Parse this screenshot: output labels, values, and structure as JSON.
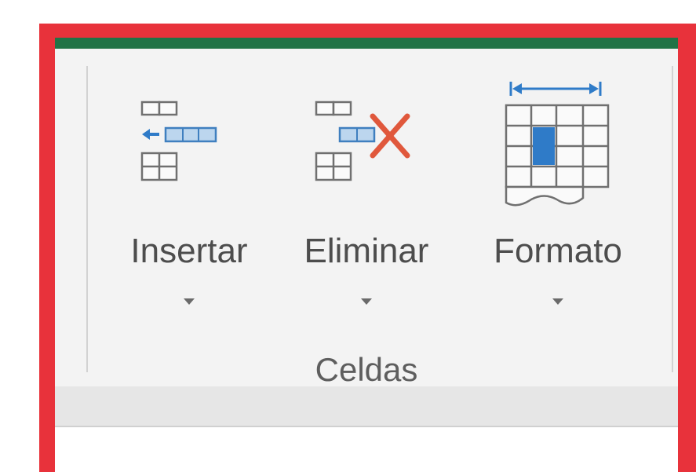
{
  "ribbon": {
    "group_label": "Celdas",
    "commands": [
      {
        "id": "insert",
        "label": "Insertar",
        "icon": "insert-cells-icon"
      },
      {
        "id": "delete",
        "label": "Eliminar",
        "icon": "delete-cells-icon"
      },
      {
        "id": "format",
        "label": "Formato",
        "icon": "format-cells-icon"
      }
    ]
  },
  "colors": {
    "highlight_border": "#e8323b",
    "accent_bar": "#217346",
    "icon_blue": "#2f7bc8",
    "delete_x": "#e0583c"
  }
}
